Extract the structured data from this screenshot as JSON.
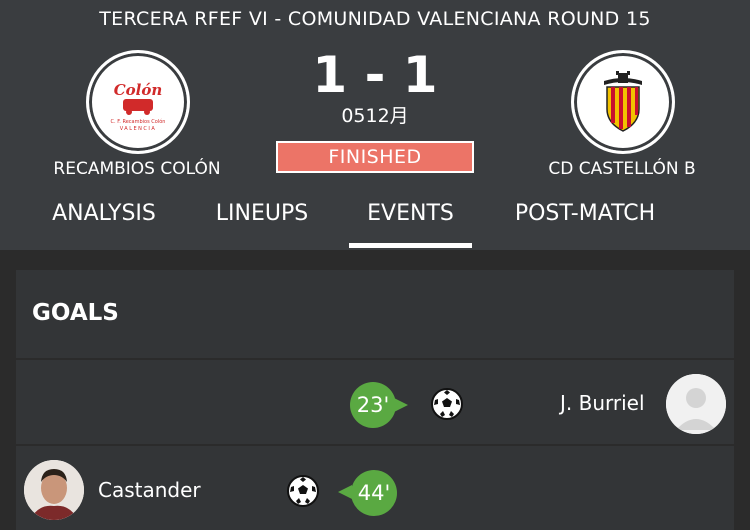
{
  "match": {
    "competition": "TERCERA RFEF  VI - COMUNIDAD VALENCIANA ROUND 15",
    "score": "1 - 1",
    "date": "0512月",
    "status": "FINISHED",
    "home_team": "RECAMBIOS COLÓN",
    "away_team": "CD CASTELLÓN B",
    "home_logo_text": "Colón",
    "home_logo_subtext": "C. F. Recambios Colón",
    "home_logo_city": "VALENCIA"
  },
  "tabs": [
    {
      "label": "ANALYSIS"
    },
    {
      "label": "LINEUPS"
    },
    {
      "label": "EVENTS",
      "active": true
    },
    {
      "label": "POST-MATCH"
    }
  ],
  "goals": {
    "title": "GOALS",
    "events": [
      {
        "side": "away",
        "minute": "23'",
        "player": "J. Burriel"
      },
      {
        "side": "home",
        "minute": "44'",
        "player": "Castander"
      }
    ]
  },
  "colors": {
    "header_bg": "#3a3d40",
    "status_bg": "#ec7467",
    "minute_bg": "#5aa942",
    "card_bg": "#333537"
  }
}
